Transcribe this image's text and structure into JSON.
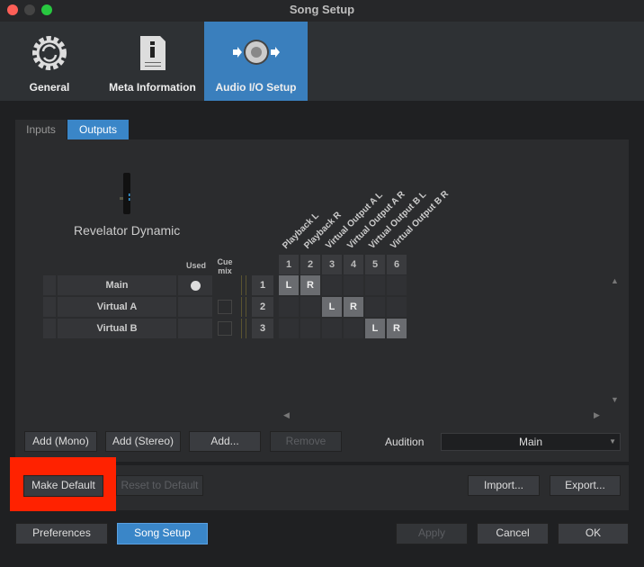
{
  "window": {
    "title": "Song Setup"
  },
  "top_tabs": [
    {
      "label": "General",
      "icon": "gear-sync-icon"
    },
    {
      "label": "Meta Information",
      "icon": "info-document-icon"
    },
    {
      "label": "Audio I/O Setup",
      "icon": "speaker-io-icon",
      "selected": true
    }
  ],
  "sub_tabs": [
    {
      "label": "Inputs"
    },
    {
      "label": "Outputs",
      "selected": true
    }
  ],
  "device": {
    "name": "Revelator Dynamic",
    "icon": "microphone-icon"
  },
  "grid": {
    "headers": {
      "used": "Used",
      "cue_mix": "Cue mix"
    },
    "columns": [
      {
        "num": "1",
        "label": "Playback L"
      },
      {
        "num": "2",
        "label": "Playback R"
      },
      {
        "num": "3",
        "label": "Virtual Output A L"
      },
      {
        "num": "4",
        "label": "Virtual Output A R"
      },
      {
        "num": "5",
        "label": "Virtual Output B L"
      },
      {
        "num": "6",
        "label": "Virtual Output B R"
      }
    ],
    "rows": [
      {
        "name": "Main",
        "num": "1",
        "used": true,
        "cue_mix": null,
        "assign": [
          "L",
          "R",
          "",
          "",
          "",
          ""
        ]
      },
      {
        "name": "Virtual A",
        "num": "2",
        "used": false,
        "cue_mix": false,
        "assign": [
          "",
          "",
          "L",
          "R",
          "",
          ""
        ]
      },
      {
        "name": "Virtual B",
        "num": "3",
        "used": false,
        "cue_mix": false,
        "assign": [
          "",
          "",
          "",
          "",
          "L",
          "R"
        ]
      }
    ]
  },
  "buttons": {
    "add_mono": "Add (Mono)",
    "add_stereo": "Add (Stereo)",
    "add": "Add...",
    "remove": "Remove",
    "make_default": "Make Default",
    "reset_default": "Reset to Default",
    "import": "Import...",
    "export": "Export...",
    "preferences": "Preferences",
    "song_setup": "Song Setup",
    "apply": "Apply",
    "cancel": "Cancel",
    "ok": "OK"
  },
  "audition": {
    "label": "Audition",
    "value": "Main"
  },
  "colors": {
    "accent": "#3a7fbd",
    "highlight": "#ff2200"
  }
}
